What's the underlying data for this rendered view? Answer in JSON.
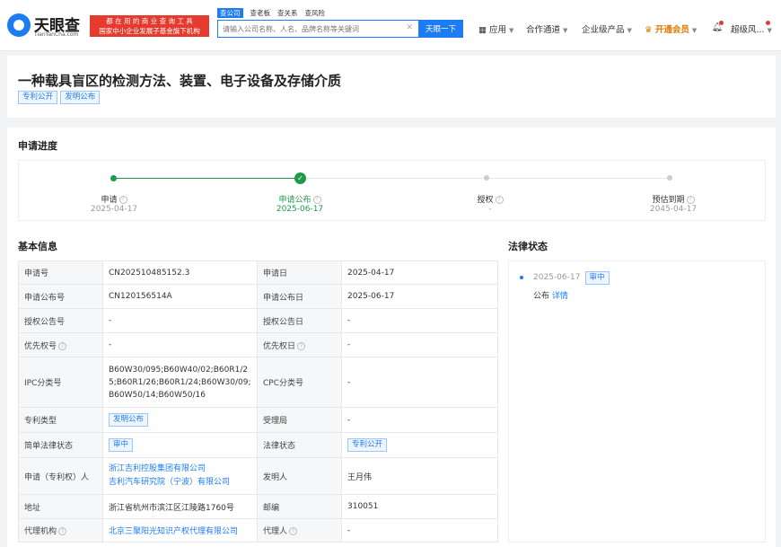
{
  "header": {
    "logo_text": "天眼查",
    "logo_sub": "TianYanCha.com",
    "banner_line1": "都 在 用 的 商 业 查 询 工 具",
    "banner_line2": "国家中小企业发展子基金旗下机构",
    "search_tabs": [
      "查公司",
      "查老板",
      "查关系",
      "查风险"
    ],
    "search_placeholder": "请输入公司名称、人名、品牌名称等关键词",
    "search_button": "天眼一下",
    "nav": {
      "app": "应用",
      "channel": "合作通道",
      "enterprise": "企业级产品",
      "vip": "开通会员",
      "user": "超级风..."
    }
  },
  "patent": {
    "title": "一种载具盲区的检测方法、装置、电子设备及存储介质",
    "tags": [
      "专利公开",
      "发明公布"
    ]
  },
  "progress": {
    "title": "申请进度",
    "steps": [
      {
        "label": "申请",
        "date": "2025-04-17"
      },
      {
        "label": "申请公布",
        "date": "2025-06-17"
      },
      {
        "label": "授权",
        "date": "-"
      },
      {
        "label": "预估到期",
        "date": "2045-04-17"
      }
    ]
  },
  "basic_info": {
    "title": "基本信息",
    "rows": [
      {
        "k1": "申请号",
        "v1": "CN202510485152.3",
        "k2": "申请日",
        "v2": "2025-04-17"
      },
      {
        "k1": "申请公布号",
        "v1": "CN120156514A",
        "k2": "申请公布日",
        "v2": "2025-06-17"
      },
      {
        "k1": "授权公告号",
        "v1": "-",
        "k2": "授权公告日",
        "v2": "-"
      },
      {
        "k1": "优先权号",
        "v1": "-",
        "k2": "优先权日",
        "v2": "-"
      },
      {
        "k1": "IPC分类号",
        "v1": "B60W30/095;B60W40/02;B60R1/25;B60R1/26;B60R1/24;B60W30/09;B60W50/14;B60W50/16",
        "k2": "CPC分类号",
        "v2": "-"
      },
      {
        "k1": "专利类型",
        "v1": "发明公布",
        "k2": "受理局",
        "v2": "-"
      },
      {
        "k1": "简单法律状态",
        "v1": "审中",
        "k2": "法律状态",
        "v2": "专利公开"
      },
      {
        "k1": "申请（专利权）人",
        "v1a": "浙江吉利控股集团有限公司",
        "v1b": "吉利汽车研究院（宁波）有限公司",
        "k2": "发明人",
        "v2": "王月伟"
      },
      {
        "k1": "地址",
        "v1": "浙江省杭州市滨江区江陵路1760号",
        "k2": "邮编",
        "v2": "310051"
      },
      {
        "k1": "代理机构",
        "v1": "北京三聚阳光知识产权代理有限公司",
        "k2": "代理人",
        "v2": "-"
      }
    ]
  },
  "legal_status": {
    "title": "法律状态",
    "date": "2025-06-17",
    "badge": "审中",
    "event": "公布",
    "detail_link": "详情"
  },
  "colors": {
    "primary": "#1d7cf2",
    "success": "#1e9a4a",
    "banner": "#e63a2e",
    "vip": "#e07b00"
  }
}
